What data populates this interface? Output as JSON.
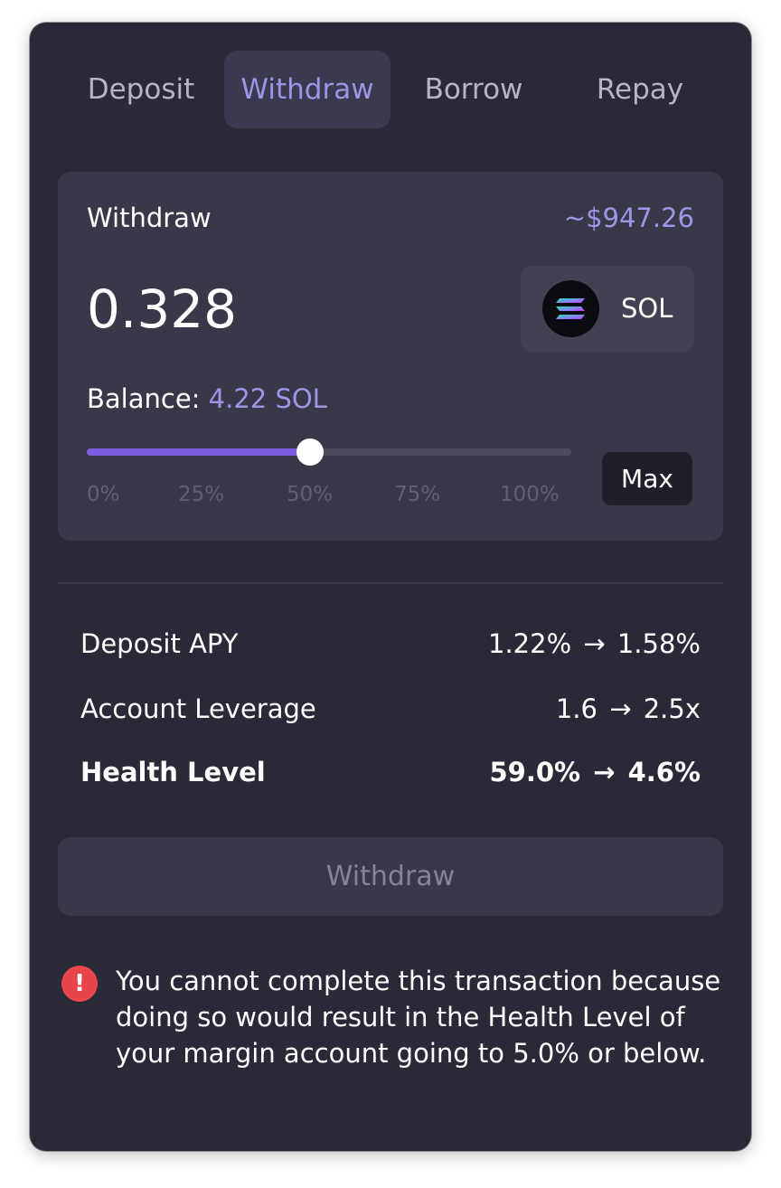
{
  "tabs": [
    {
      "label": "Deposit",
      "active": false
    },
    {
      "label": "Withdraw",
      "active": true
    },
    {
      "label": "Borrow",
      "active": false
    },
    {
      "label": "Repay",
      "active": false
    }
  ],
  "card": {
    "label": "Withdraw",
    "usd_value": "~$947.26",
    "amount": "0.328",
    "token": {
      "symbol": "SOL",
      "icon": "solana-logo-icon"
    },
    "balance_label": "Balance:",
    "balance_value": "4.22 SOL",
    "slider": {
      "value_percent": 46,
      "ticks": [
        "0%",
        "25%",
        "50%",
        "75%",
        "100%"
      ]
    },
    "max_label": "Max"
  },
  "stats": [
    {
      "label": "Deposit APY",
      "value": "1.22% → 1.58%",
      "bold": false
    },
    {
      "label": "Account Leverage",
      "value": "1.6 → 2.5x",
      "bold": false
    },
    {
      "label": "Health Level",
      "value": "59.0% → 4.6%",
      "bold": true
    }
  ],
  "submit_label": "Withdraw",
  "error": {
    "icon": "error-exclamation-icon",
    "message": "You cannot complete this transaction because doing so would result in the Health Level of your margin account going to 5.0% or below."
  },
  "colors": {
    "accent": "#9d95e6",
    "slider_fill": "#7b5fe0",
    "panel_bg": "#2a2937",
    "card_bg": "#393848",
    "error": "#e8454a"
  }
}
